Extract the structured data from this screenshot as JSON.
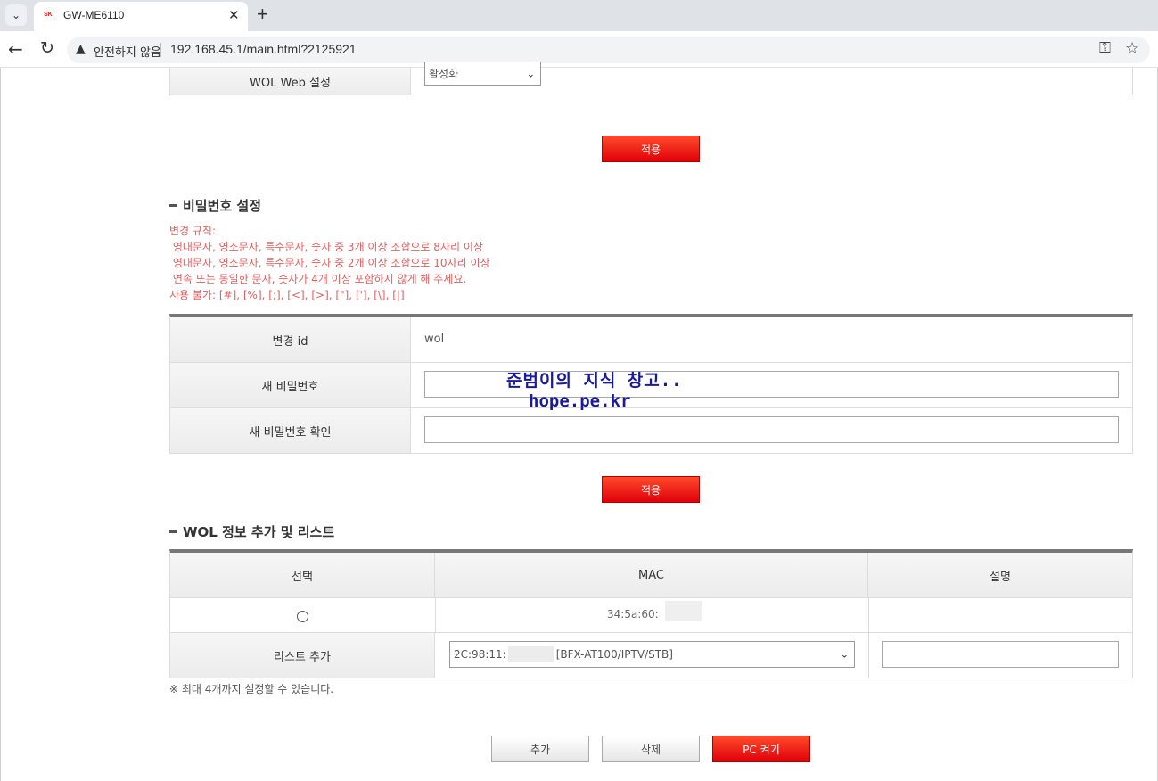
{
  "browser": {
    "tab_title": "GW-ME6110",
    "tab_favicon_text": "SK",
    "insecure_label": "안전하지 않음",
    "url": "192.168.45.1/main.html?2125921"
  },
  "wol_web": {
    "label": "WOL Web 설정",
    "selected": "활성화",
    "apply_label": "적용"
  },
  "password": {
    "section_title": "비밀번호 설정",
    "rules": [
      "변경 규칙:",
      " 영대문자, 영소문자, 특수문자, 숫자 중 3개 이상 조합으로 8자리 이상",
      " 영대문자, 영소문자, 특수문자, 숫자 중 2개 이상 조합으로 10자리 이상",
      " 연속 또는 동일한 문자, 숫자가 4개 이상 포함하지 않게 해 주세요.",
      "사용 불가: [#], [%], [;], [<], [>], [\"], ['], [\\], [|]"
    ],
    "id_label": "변경 id",
    "id_value": "wol",
    "new_pw_label": "새 비밀번호",
    "confirm_pw_label": "새 비밀번호 확인",
    "apply_label": "적용"
  },
  "watermark": {
    "line1": "준범이의 지식 창고..",
    "line2": "hope.pe.kr"
  },
  "wol_list": {
    "section_title": "WOL 정보 추가 및 리스트",
    "headers": [
      "선택",
      "MAC",
      "설명"
    ],
    "rows": [
      {
        "mac": "34:5a:60:",
        "desc": ""
      }
    ],
    "add_row_label": "리스트 추가",
    "device_select_prefix": "2C:98:11:",
    "device_select_suffix": "[BFX-AT100/IPTV/STB]",
    "note": "※ 최대 4개까지 설정할 수 있습니다.",
    "add_button": "추가",
    "delete_button": "삭제",
    "power_on_button": "PC 켜기"
  }
}
